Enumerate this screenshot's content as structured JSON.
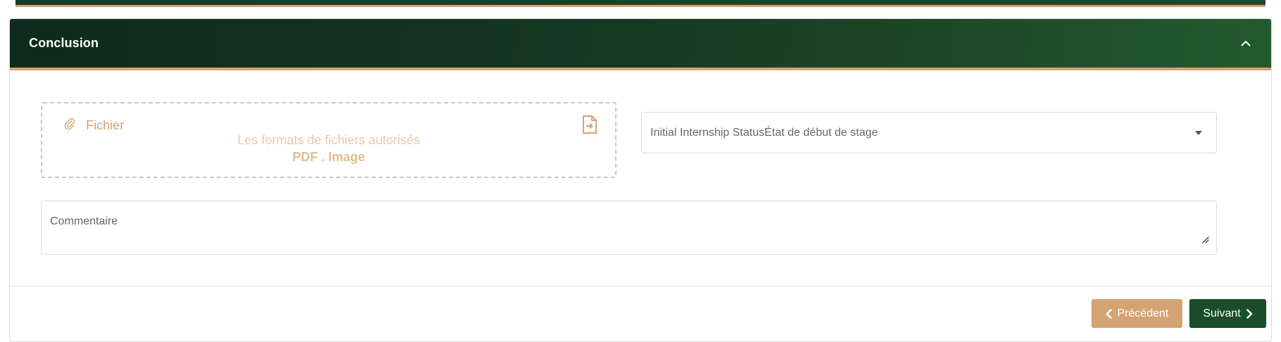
{
  "section": {
    "title": "Conclusion",
    "collapse_icon": "chevron-up-icon"
  },
  "upload": {
    "label": "Fichier",
    "hint": "Les formats de fichiers autorisés",
    "formats": "PDF . Image",
    "label_icon": "paperclip-icon",
    "action_icon": "file-import-icon"
  },
  "status_select": {
    "value": "Initial Internship StatusÉtat de début de stage"
  },
  "comment": {
    "placeholder": "Commentaire"
  },
  "footer": {
    "prev_label": "Précédent",
    "next_label": "Suivant"
  },
  "colors": {
    "accent": "#d4a373",
    "header_dark": "#0f2a1e",
    "header_light": "#245a2f",
    "primary_button": "#1b4d2b"
  }
}
